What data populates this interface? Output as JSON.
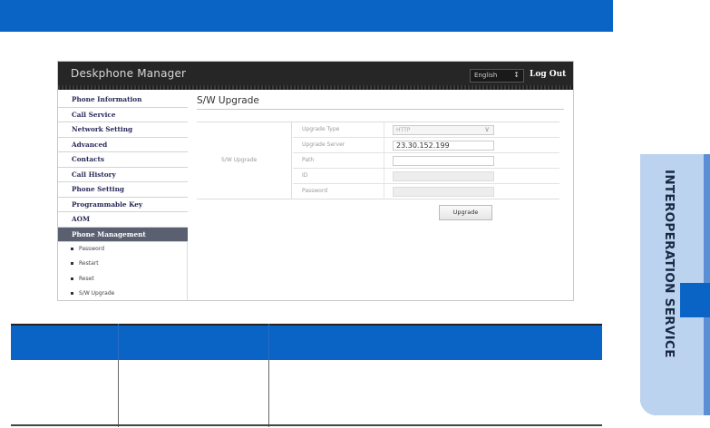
{
  "app": {
    "title": "Deskphone Manager",
    "language": "English",
    "logout_label": "Log Out"
  },
  "sidebar": {
    "items": [
      {
        "label": "Phone Information"
      },
      {
        "label": "Call Service"
      },
      {
        "label": "Network Setting"
      },
      {
        "label": "Advanced"
      },
      {
        "label": "Contacts"
      },
      {
        "label": "Call History"
      },
      {
        "label": "Phone Setting"
      },
      {
        "label": "Programmable Key"
      },
      {
        "label": "AOM"
      },
      {
        "label": "Phone Management",
        "active": true
      }
    ],
    "subitems": [
      {
        "label": "Password"
      },
      {
        "label": "Restart"
      },
      {
        "label": "Reset"
      },
      {
        "label": "S/W Upgrade"
      }
    ]
  },
  "main": {
    "page_title": "S/W Upgrade",
    "section_label": "S/W Upgrade",
    "fields": [
      {
        "label": "Upgrade Type",
        "value": "HTTP",
        "kind": "select"
      },
      {
        "label": "Upgrade Server",
        "value": "23.30.152.199",
        "kind": "text"
      },
      {
        "label": "Path",
        "value": "",
        "kind": "text"
      },
      {
        "label": "ID",
        "value": "",
        "kind": "disabled"
      },
      {
        "label": "Password",
        "value": "",
        "kind": "disabled"
      }
    ],
    "upgrade_button": "Upgrade"
  },
  "side_tab": {
    "label": "INTEROPERATION SERVICE"
  },
  "colors": {
    "accent_blue": "#0a64c6",
    "header_dark": "#262626",
    "active_item": "#5a6070",
    "side_tab_light": "#bcd3ef"
  }
}
